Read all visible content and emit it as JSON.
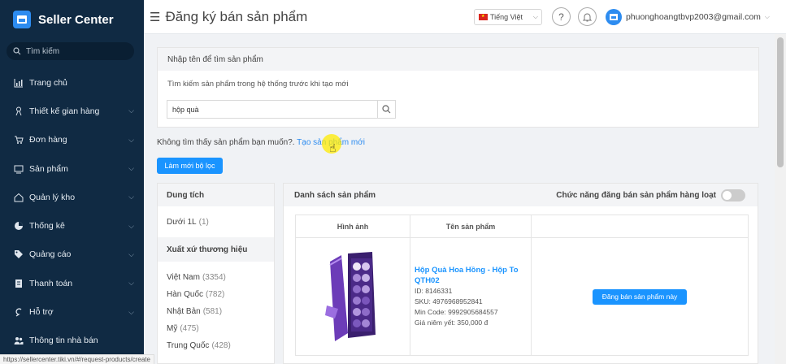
{
  "sidebar": {
    "brand": "Seller Center",
    "search_label": "Tìm kiếm",
    "items": [
      {
        "label": "Trang chủ",
        "icon": "chart-icon",
        "chevron": false
      },
      {
        "label": "Thiết kế gian hàng",
        "icon": "design-icon",
        "chevron": true
      },
      {
        "label": "Đơn hàng",
        "icon": "cart-icon",
        "chevron": true
      },
      {
        "label": "Sản phẩm",
        "icon": "monitor-icon",
        "chevron": true
      },
      {
        "label": "Quản lý kho",
        "icon": "home-icon",
        "chevron": true
      },
      {
        "label": "Thống kê",
        "icon": "pie-icon",
        "chevron": true
      },
      {
        "label": "Quảng cáo",
        "icon": "tag-icon",
        "chevron": true
      },
      {
        "label": "Thanh toán",
        "icon": "bill-icon",
        "chevron": true
      },
      {
        "label": "Hỗ trợ",
        "icon": "support-icon",
        "chevron": true
      },
      {
        "label": "Thông tin nhà bán",
        "icon": "people-icon",
        "chevron": false
      }
    ]
  },
  "topbar": {
    "title": "Đăng ký bán sản phẩm",
    "language": "Tiếng Việt",
    "email": "phuonghoangtbvp2003@gmail.com"
  },
  "search_card": {
    "header": "Nhập tên để tìm sản phẩm",
    "hint": "Tìm kiếm sản phẩm trong hệ thống trước khi tạo mới",
    "query": "hộp quà"
  },
  "not_found": {
    "text": "Không tìm thấy sản phẩm bạn muốn?.",
    "link": "Tạo sản phẩm mới"
  },
  "refresh_button": "Làm mới bộ lọc",
  "filters": {
    "groups": [
      {
        "title": "Dung tích",
        "items": [
          {
            "label": "Dưới 1L",
            "count": "(1)"
          }
        ]
      },
      {
        "title": "Xuất xứ thương hiệu",
        "items": [
          {
            "label": "Việt Nam",
            "count": "(3354)"
          },
          {
            "label": "Hàn Quốc",
            "count": "(782)"
          },
          {
            "label": "Nhật Bản",
            "count": "(581)"
          },
          {
            "label": "Mỹ",
            "count": "(475)"
          },
          {
            "label": "Trung Quốc",
            "count": "(428)"
          }
        ]
      }
    ]
  },
  "products": {
    "header": "Danh sách sản phẩm",
    "bulk_label": "Chức năng đăng bán sản phẩm hàng loạt",
    "columns": [
      "Hình ảnh",
      "Tên sản phẩm",
      ""
    ],
    "rows": [
      {
        "name": "Hộp Quà Hoa Hồng - Hộp To QTH02",
        "id": "ID: 8146331",
        "sku": "SKU: 4976968952841",
        "min_code": "Min Code: 9992905684557",
        "price": "Giá niêm yết: 350,000 đ",
        "action": "Đăng bán sản phẩm này"
      }
    ]
  },
  "status_url": "https://sellercenter.tiki.vn/#/request-products/create",
  "colors": {
    "sidebar_bg": "#102a43",
    "primary": "#1a94ff"
  }
}
